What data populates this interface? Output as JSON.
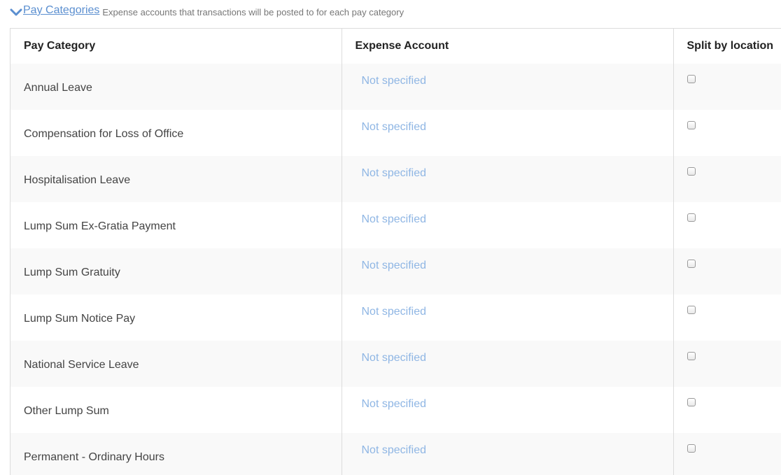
{
  "section": {
    "toggle_label": "Pay Categories",
    "description": "Expense accounts that transactions will be posted to for each pay category",
    "icon": "chevron-down-icon",
    "accent_color": "#5b8fd0"
  },
  "table": {
    "columns": [
      "Pay Category",
      "Expense Account",
      "Split by location"
    ],
    "rows": [
      {
        "category": "Annual Leave",
        "expense_account": "Not specified",
        "split_by_location": false
      },
      {
        "category": "Compensation for Loss of Office",
        "expense_account": "Not specified",
        "split_by_location": false
      },
      {
        "category": "Hospitalisation Leave",
        "expense_account": "Not specified",
        "split_by_location": false
      },
      {
        "category": "Lump Sum Ex-Gratia Payment",
        "expense_account": "Not specified",
        "split_by_location": false
      },
      {
        "category": "Lump Sum Gratuity",
        "expense_account": "Not specified",
        "split_by_location": false
      },
      {
        "category": "Lump Sum Notice Pay",
        "expense_account": "Not specified",
        "split_by_location": false
      },
      {
        "category": "National Service Leave",
        "expense_account": "Not specified",
        "split_by_location": false
      },
      {
        "category": "Other Lump Sum",
        "expense_account": "Not specified",
        "split_by_location": false
      },
      {
        "category": "Permanent - Ordinary Hours",
        "expense_account": "Not specified",
        "split_by_location": false
      }
    ]
  }
}
